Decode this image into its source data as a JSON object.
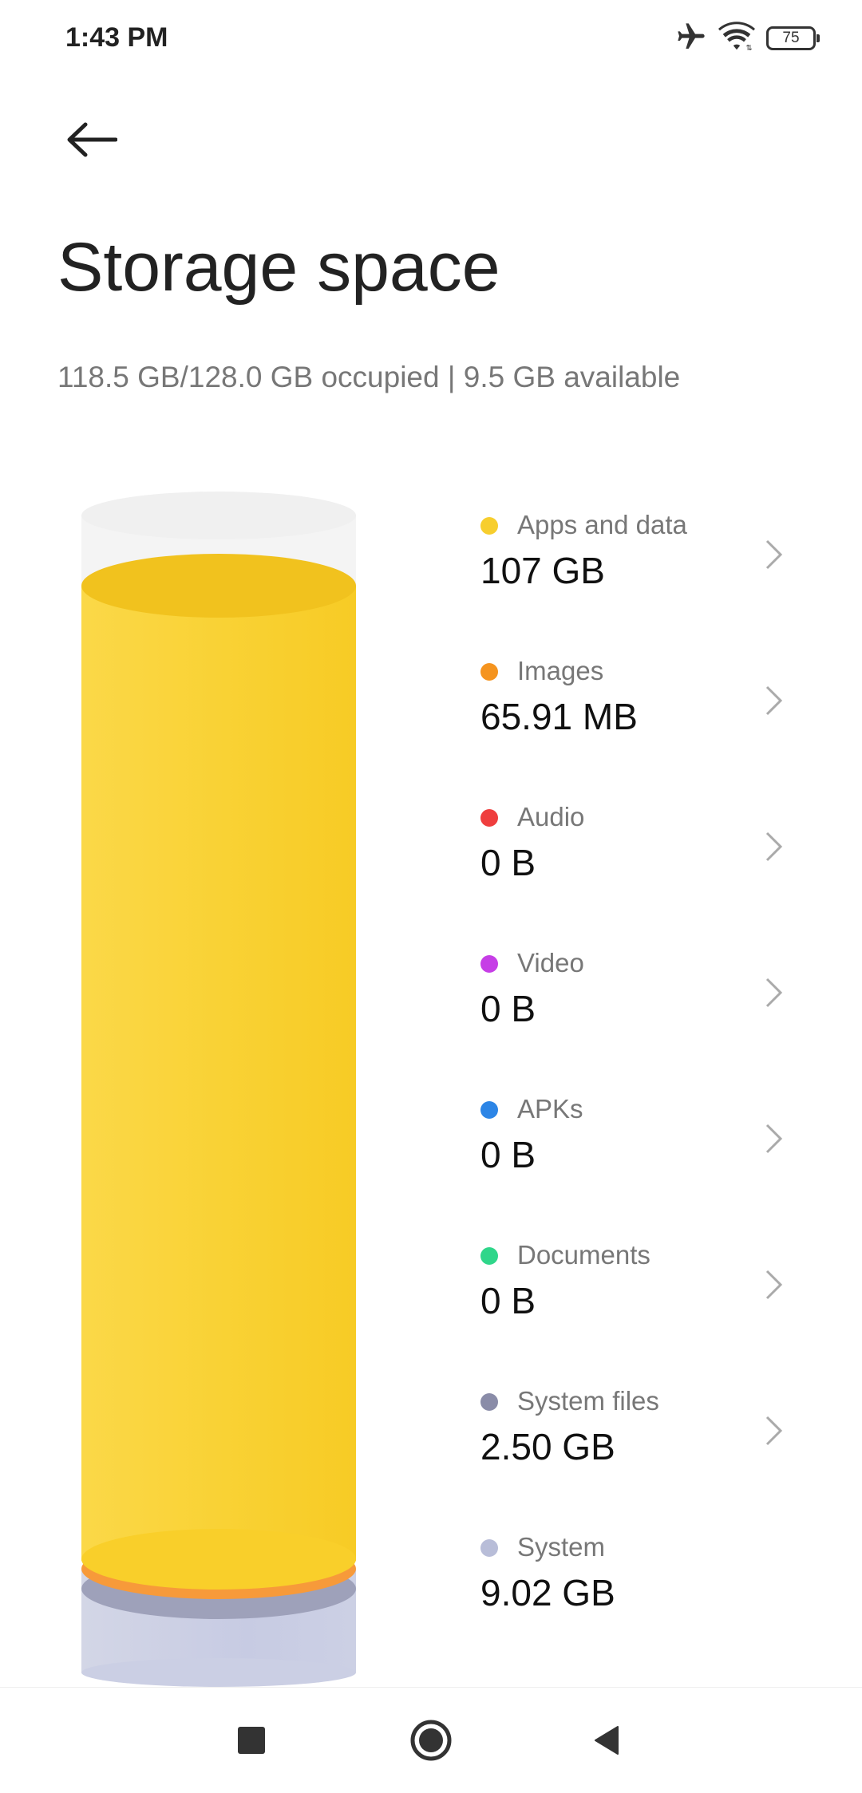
{
  "status_bar": {
    "time": "1:43 PM",
    "battery_level": "75",
    "icons": [
      "airplane-icon",
      "wifi-icon",
      "battery-icon"
    ]
  },
  "header": {
    "back_icon": "back-arrow-icon"
  },
  "page": {
    "title": "Storage space",
    "summary": "118.5 GB/128.0 GB occupied | 9.5 GB available"
  },
  "categories": [
    {
      "label": "Apps and data",
      "value": "107 GB",
      "color": "#F7CE2E",
      "has_chevron": true
    },
    {
      "label": "Images",
      "value": "65.91 MB",
      "color": "#F5941F",
      "has_chevron": true
    },
    {
      "label": "Audio",
      "value": "0 B",
      "color": "#EF3E3E",
      "has_chevron": true
    },
    {
      "label": "Video",
      "value": "0 B",
      "color": "#C63EE6",
      "has_chevron": true
    },
    {
      "label": "APKs",
      "value": "0 B",
      "color": "#2C85E6",
      "has_chevron": true
    },
    {
      "label": "Documents",
      "value": "0 B",
      "color": "#2FD68A",
      "has_chevron": true
    },
    {
      "label": "System files",
      "value": "2.50 GB",
      "color": "#8A8CA8",
      "has_chevron": true
    },
    {
      "label": "System",
      "value": "9.02 GB",
      "color": "#B8BDD8",
      "has_chevron": false
    }
  ],
  "cylinder_colors": {
    "empty": "#F2F2F2",
    "apps": "#F9D030",
    "images": "#F79A3A",
    "system_files": "#A0A3BC",
    "system": "#CBCFE4"
  },
  "nav_bar": {
    "buttons": [
      "recents-square-icon",
      "home-circle-icon",
      "back-triangle-icon"
    ]
  }
}
